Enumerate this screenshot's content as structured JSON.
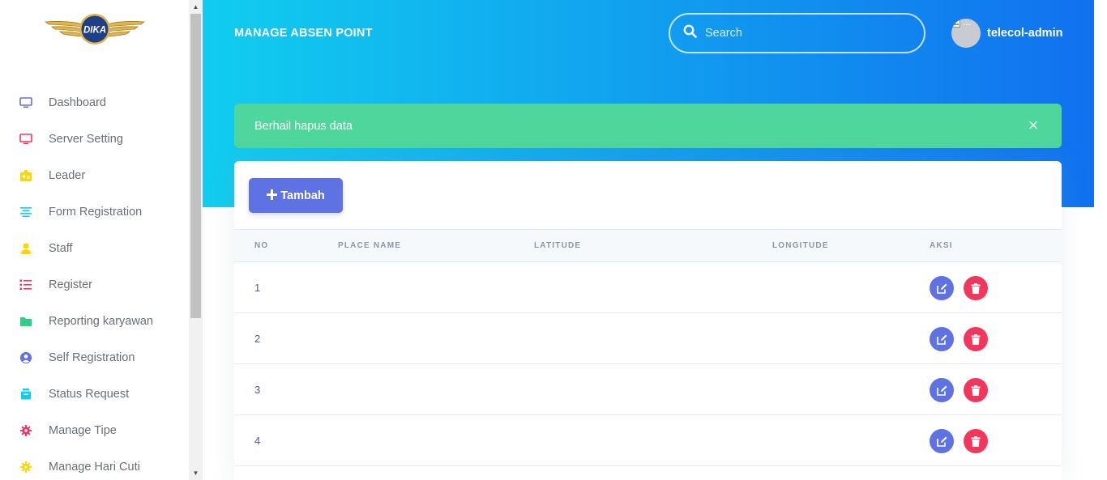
{
  "app": {
    "logo_text": "DIKA"
  },
  "sidebar": {
    "items": [
      {
        "label": "Dashboard",
        "icon": "monitor-icon",
        "color": "#5e72e4"
      },
      {
        "label": "Server Setting",
        "icon": "monitor-icon",
        "color": "#f5365c"
      },
      {
        "label": "Leader",
        "icon": "badge-icon",
        "color": "#ffd600"
      },
      {
        "label": "Form Registration",
        "icon": "align-center-icon",
        "color": "#11cdef"
      },
      {
        "label": "Staff",
        "icon": "user-icon",
        "color": "#ffd600"
      },
      {
        "label": "Register",
        "icon": "list-icon",
        "color": "#f5365c"
      },
      {
        "label": "Reporting karyawan",
        "icon": "folder-icon",
        "color": "#2dce89"
      },
      {
        "label": "Self Registration",
        "icon": "user-circle-icon",
        "color": "#5e72e4"
      },
      {
        "label": "Status Request",
        "icon": "archive-icon",
        "color": "#11cdef"
      },
      {
        "label": "Manage Tipe",
        "icon": "gear-icon",
        "color": "#f5365c"
      },
      {
        "label": "Manage Hari Cuti",
        "icon": "gear-icon",
        "color": "#ffd600"
      }
    ]
  },
  "header": {
    "title": "MANAGE ABSEN POINT",
    "search_placeholder": "Search",
    "username": "telecol-admin",
    "avatar_alt": "..."
  },
  "alert": {
    "message": "Berhail hapus data",
    "close": "×"
  },
  "toolbar": {
    "add_label": "Tambah"
  },
  "table": {
    "columns": [
      "NO",
      "PLACE NAME",
      "LATITUDE",
      "LONGITUDE",
      "AKSI"
    ],
    "rows": [
      {
        "no": "1",
        "place_name": "",
        "latitude": "",
        "longitude": ""
      },
      {
        "no": "2",
        "place_name": "",
        "latitude": "",
        "longitude": ""
      },
      {
        "no": "3",
        "place_name": "",
        "latitude": "",
        "longitude": ""
      },
      {
        "no": "4",
        "place_name": "",
        "latitude": "",
        "longitude": ""
      }
    ]
  },
  "colors": {
    "gradient_start": "#11cdef",
    "gradient_end": "#1171ef",
    "primary": "#5e72e4",
    "danger": "#f5365c",
    "success": "#4fd69c"
  }
}
